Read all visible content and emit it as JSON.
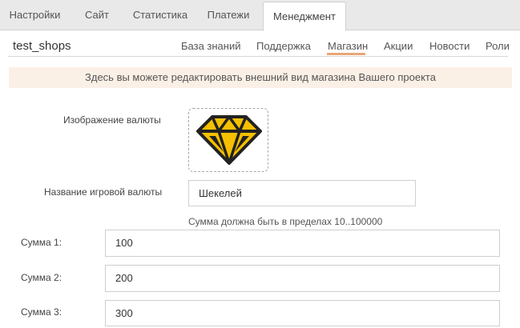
{
  "top_tabs": [
    {
      "label": "Настройки"
    },
    {
      "label": "Сайт"
    },
    {
      "label": "Статистика"
    },
    {
      "label": "Платежи"
    },
    {
      "label": "Менеджмент",
      "active": true
    }
  ],
  "project": {
    "name": "test_shops"
  },
  "sub_tabs": [
    {
      "label": "База знаний"
    },
    {
      "label": "Поддержка"
    },
    {
      "label": "Магазин",
      "active": true
    },
    {
      "label": "Акции"
    },
    {
      "label": "Новости"
    },
    {
      "label": "Роли"
    }
  ],
  "notice": "Здесь вы можете редактировать внешний вид магазина Вашего проекта",
  "form": {
    "currency_image_label": "Изображение валюты",
    "currency_image_icon": "diamond-icon",
    "currency_name_label": "Название игровой валюты",
    "currency_name_value": "Шекелей",
    "range_hint": "Сумма должна быть в пределах 10..100000",
    "amounts": [
      {
        "label": "Сумма 1:",
        "value": "100"
      },
      {
        "label": "Сумма 2:",
        "value": "200"
      },
      {
        "label": "Сумма 3:",
        "value": "300"
      }
    ]
  },
  "colors": {
    "accent": "#e8a678",
    "notice_bg": "#fbf0e6",
    "tab_bar_bg": "#e9e9e9"
  }
}
